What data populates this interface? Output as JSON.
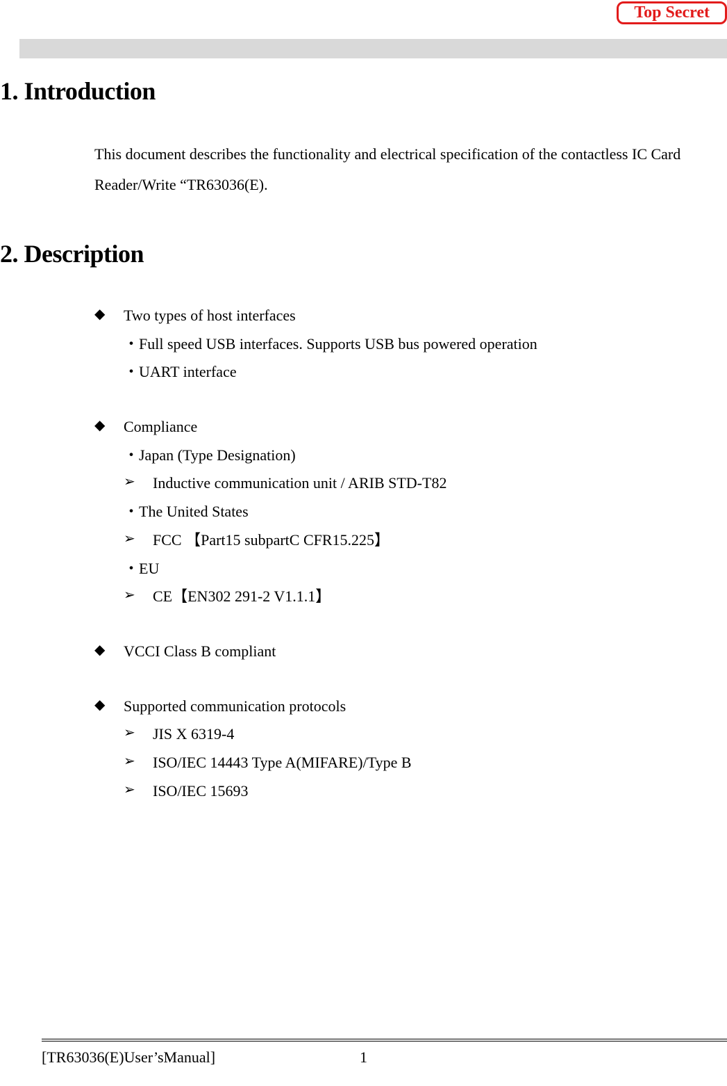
{
  "badge": {
    "label": "Top Secret"
  },
  "section1": {
    "heading": "1. Introduction",
    "paragraph": "This document describes the functionality and electrical specification of the contactless IC Card Reader/Write “TR63036(E)."
  },
  "section2": {
    "heading": "2. Description",
    "item1": {
      "title": "Two types of host interfaces",
      "dot1": "・Full speed USB interfaces. Supports USB bus powered operation",
      "dot2": "・UART interface"
    },
    "item2": {
      "title": "Compliance",
      "japan_label": "・Japan (Type Designation)",
      "japan_sub": "Inductive communication unit / ARIB STD-T82",
      "us_label": "・The United States",
      "us_sub": "FCC 【Part15 subpartC CFR15.225】",
      "eu_label": "・EU",
      "eu_sub": "CE【EN302 291-2 V1.1.1】"
    },
    "item3": {
      "title": "VCCI Class B compliant"
    },
    "item4": {
      "title": "Supported communication protocols",
      "sub1": "JIS X 6319-4",
      "sub2": "ISO/IEC 14443 Type A(MIFARE)/Type B",
      "sub3": "ISO/IEC 15693"
    }
  },
  "footer": {
    "left": "[TR63036(E)User’sManual]",
    "page": "1"
  },
  "markers": {
    "diamond": "◆",
    "chevron": "➢"
  }
}
